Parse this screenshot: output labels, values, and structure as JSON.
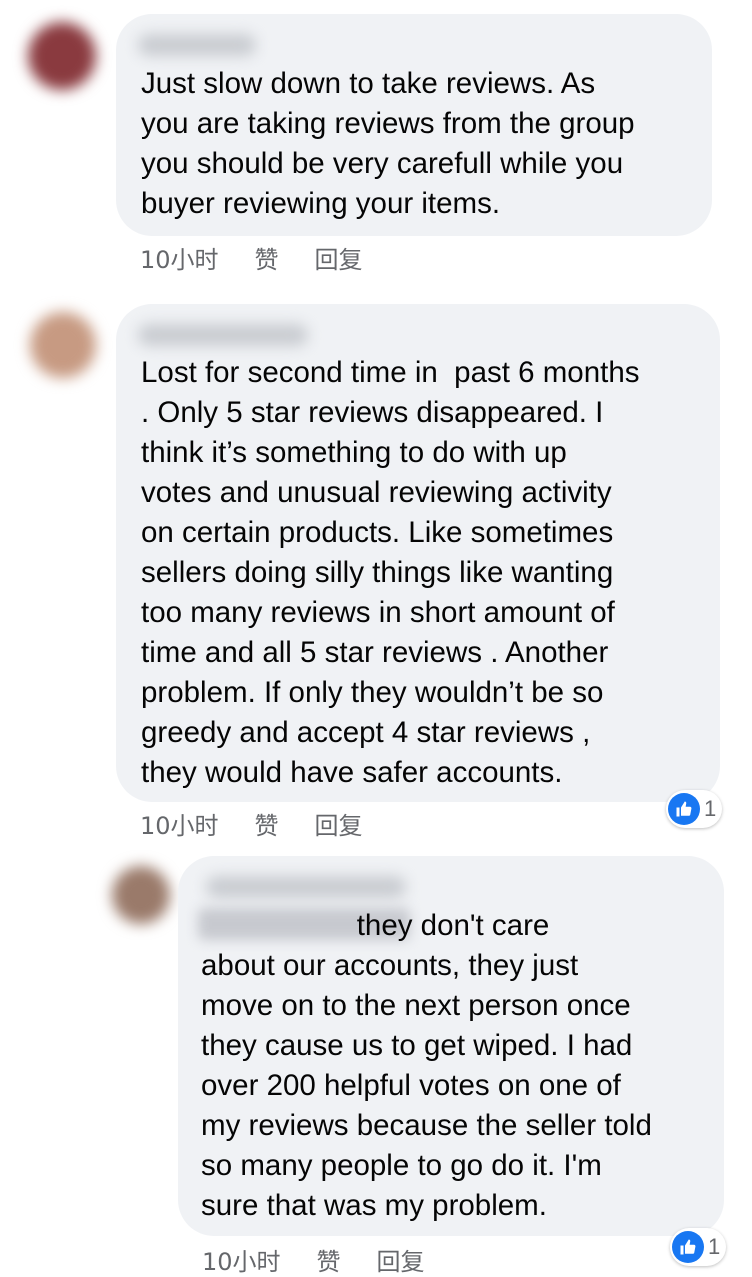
{
  "colors": {
    "bubble": "#f0f2f5",
    "text": "#050505",
    "meta": "#65676b",
    "like_blue": "#1877f2"
  },
  "comments": [
    {
      "avatar_color": "#8a3a3f",
      "text": "Just slow down to take reviews. As\nyou are taking reviews from the group\nyou should be very carefull while you\nbuyer reviewing your items.",
      "time": "10小时",
      "like_label": "赞",
      "reply_label": "回复"
    },
    {
      "avatar_color": "#c79a82",
      "text": "Lost for second time in  past 6 months\n. Only 5 star reviews disappeared. I\nthink it’s something to do with up\nvotes and unusual reviewing activity\non certain products. Like sometimes\nsellers doing silly things like wanting\ntoo many reviews in short amount of\ntime and all 5 star reviews . Another\nproblem. If only they wouldn’t be so\ngreedy and accept 4 star reviews ,\nthey would have safer accounts.",
      "time": "10小时",
      "like_label": "赞",
      "reply_label": "回复",
      "reaction_icon": "thumbs-up-icon",
      "reaction_count": "1"
    },
    {
      "avatar_color": "#9a7a6a",
      "text": "                   they don't care\nabout our accounts, they just\nmove on to the next person once\nthey cause us to get wiped. I had\nover 200 helpful votes on one of\nmy reviews because the seller told\nso many people to go do it. I'm\nsure that was my problem.",
      "time": "10小时",
      "like_label": "赞",
      "reply_label": "回复",
      "reaction_icon": "thumbs-up-icon",
      "reaction_count": "1"
    }
  ]
}
